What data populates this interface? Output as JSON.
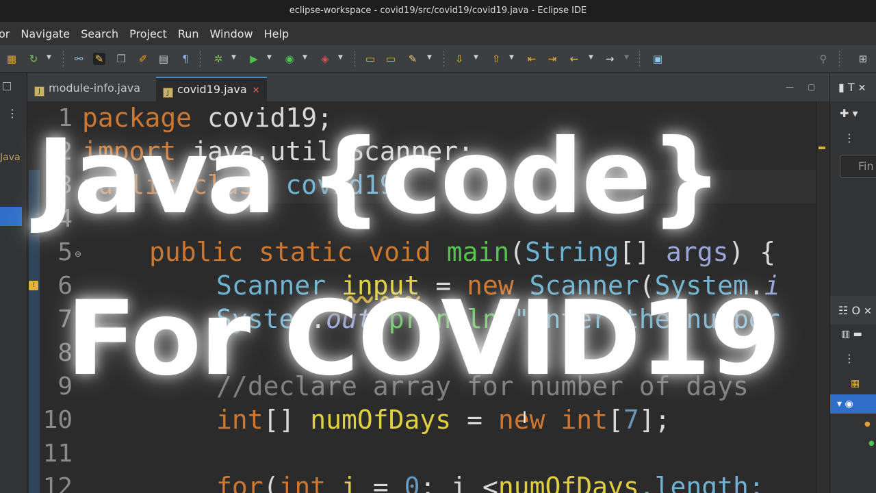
{
  "window": {
    "title": "eclipse-workspace - covid19/src/covid19/covid19.java - Eclipse IDE"
  },
  "menu": {
    "items": [
      "or",
      "Navigate",
      "Search",
      "Project",
      "Run",
      "Window",
      "Help"
    ]
  },
  "tabs": [
    {
      "label": "module-info.java",
      "active": false
    },
    {
      "label": "covid19.java",
      "active": true
    }
  ],
  "left_panel": {
    "label": "Java"
  },
  "right_panel": {
    "top_label": "T",
    "find_placeholder": "Fin",
    "outline_label": "O"
  },
  "editor": {
    "line_numbers": [
      "1",
      "2",
      "3",
      "4",
      "5",
      "6",
      "7",
      "8",
      "9",
      "10",
      "11",
      "12"
    ],
    "lines": {
      "l1_kw": "package",
      "l1_rest": " covid19;",
      "l2_kw": "import",
      "l2_rest": " java.util.Scanner;",
      "l3_kw": "public class",
      "l3_rest": " covid19",
      "l5_a": "public static void ",
      "l5_fn": "main",
      "l5_p": "(",
      "l5_ty": "String",
      "l5_b": "[] ",
      "l5_arg": "args",
      "l5_c": ") {",
      "l6_ty": "Scanner",
      "l6_var": "input",
      "l6_eq": " = ",
      "l6_kw": "new",
      "l6_ty2": " Scanner",
      "l6_p": "(",
      "l6_sys": "System",
      "l6_dot": ".",
      "l6_in": "i",
      "l7_sys": "System",
      "l7_dot": ".",
      "l7_out": "out",
      "l7_dot2": ".",
      "l7_fn": "println",
      "l7_str": "(\"Enter the number",
      "l9_cm": "//declare array for number of days",
      "l10_kw": "int",
      "l10_b": "[] ",
      "l10_var": "numOfDays",
      "l10_eq": " = ",
      "l10_kw2": "new",
      "l10_int": " int",
      "l10_br": "[",
      "l10_num": "7",
      "l10_end": "];",
      "l12_kw": "for",
      "l12_p": "(",
      "l12_int": "int",
      "l12_i": " i",
      "l12_eq": " = ",
      "l12_zero": "0",
      "l12_semi": "; i <",
      "l12_var": "numOfDays",
      "l12_len": ".length;"
    }
  },
  "overlay": {
    "line1": "Java {code}",
    "line2": "For COVID19"
  }
}
